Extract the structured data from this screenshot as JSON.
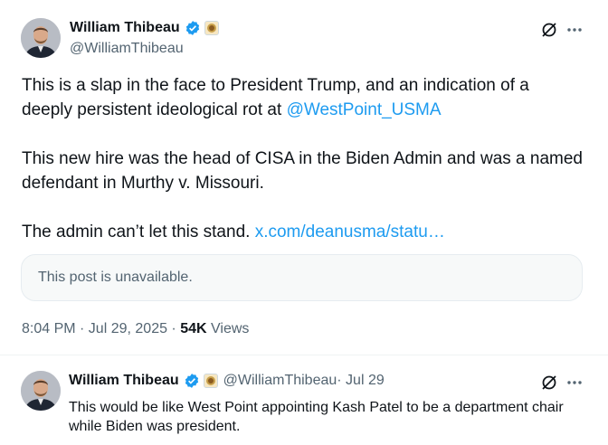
{
  "main_post": {
    "author_name": "William Thibeau",
    "handle": "@WilliamThibeau",
    "paragraphs": {
      "p1_text": "This is a slap in the face to President Trump, and an indication of a deeply persistent ideological rot at ",
      "p1_mention": "@WestPoint_USMA",
      "p2_text": "This new hire was the head of CISA in the Biden Admin and was a named defendant in Murthy v. Missouri.",
      "p3_text": "The admin can’t let this stand. ",
      "p3_link": "x.com/deanusma/statu…"
    },
    "quoted_card_text": "This post is unavailable.",
    "timestamp": "8:04 PM · Jul 29, 2025",
    "separator": " · ",
    "views_count": "54K",
    "views_label": " Views"
  },
  "reply": {
    "author_name": "William Thibeau",
    "handle": "@WilliamThibeau",
    "date": " · Jul 29",
    "text": "This would be like West Point appointing Kash Patel to be a department chair while Biden was president."
  },
  "icons": {
    "verified": "verified-badge-icon",
    "affiliation": "affiliation-badge-icon",
    "grok": "grok-icon",
    "more": "more-icon"
  },
  "colors": {
    "link": "#1d9bf0",
    "secondary_text": "#536471",
    "primary_text": "#0f1419",
    "verified": "#1d9bf0"
  }
}
